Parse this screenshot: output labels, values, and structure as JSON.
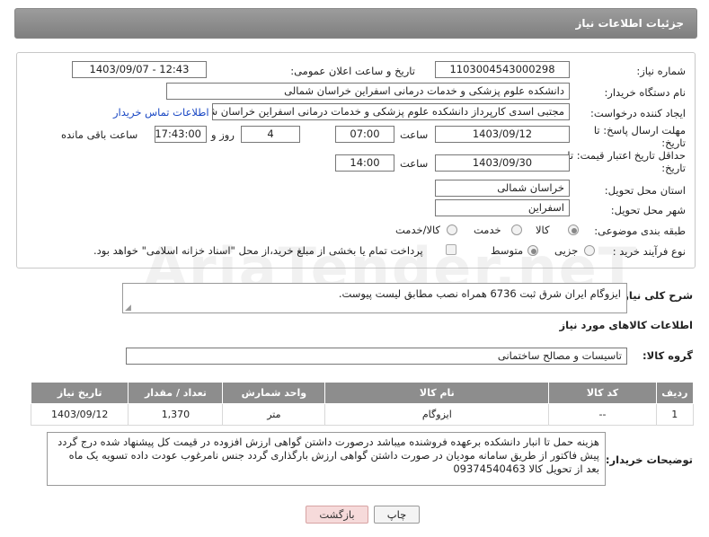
{
  "header": {
    "title": "جزئیات اطلاعات نیاز"
  },
  "form": {
    "need_number_label": "شماره نیاز:",
    "need_number": "1103004543000298",
    "announce_label": "تاریخ و ساعت اعلان عمومی:",
    "announce_value": "1403/09/07 - 12:43",
    "buyer_org_label": "نام دستگاه خریدار:",
    "buyer_org": "دانشکده علوم پزشکی و خدمات درمانی اسفراین خراسان شمالی",
    "requester_label": "ایجاد کننده درخواست:",
    "requester": "مجتبی اسدی کارپرداز  دانشکده علوم پزشکی و خدمات درمانی اسفراین خراسان شمالی",
    "contact_link": "اطلاعات تماس خریدار",
    "deadline_label_1": "مهلت ارسال پاسخ: تا",
    "deadline_label_2": "تاریخ:",
    "deadline_date": "1403/09/12",
    "time_label": "ساعت",
    "deadline_time": "07:00",
    "days_value": "4",
    "days_label": "روز و",
    "remaining_time": "17:43:00",
    "remaining_label": "ساعت باقی مانده",
    "validity_label_1": "حداقل تاریخ اعتبار قیمت: تا",
    "validity_label_2": "تاریخ:",
    "validity_date": "1403/09/30",
    "validity_time": "14:00",
    "province_label": "استان محل تحویل:",
    "province": "خراسان شمالی",
    "city_label": "شهر محل تحویل:",
    "city": "اسفراین",
    "category_label": "طبقه بندی موضوعی:",
    "category_options": [
      "کالا",
      "خدمت",
      "کالا/خدمت"
    ],
    "process_label": "نوع فرآیند خرید :",
    "process_options": [
      "جزیی",
      "متوسط"
    ],
    "payment_note": "پرداخت تمام یا بخشی از مبلغ خرید،از محل \"اسناد خزانه اسلامی\" خواهد بود."
  },
  "description": {
    "label": "شرح کلی نیاز:",
    "text": "ایزوگام ایران شرق ثبت 6736 همراه نصب مطابق لیست پیوست."
  },
  "items_section": {
    "title": "اطلاعات کالاهای مورد نیاز",
    "group_label": "گروه کالا:",
    "group_value": "تاسیسات و مصالح ساختمانی"
  },
  "table": {
    "headers": [
      "ردیف",
      "کد کالا",
      "نام کالا",
      "واحد شمارش",
      "تعداد / مقدار",
      "تاریخ نیاز"
    ],
    "rows": [
      [
        "1",
        "--",
        "ایزوگام",
        "متر",
        "1,370",
        "1403/09/12"
      ]
    ]
  },
  "buyer_notes": {
    "label": "توضیحات خریدار:",
    "text": "هزینه حمل تا انبار دانشکده برعهده فروشنده میباشد درصورت داشتن گواهی ارزش افزوده در قیمت کل پیشنهاد شده درج گردد پیش فاکتور از طریق سامانه مودیان در صورت داشتن گواهی ارزش بارگذاری گردد جنس نامرغوب عودت داده تسویه یک ماه بعد از تحویل کالا 09374540463"
  },
  "buttons": {
    "print": "چاپ",
    "back": "بازگشت"
  },
  "watermark": "AriaTender.neT"
}
